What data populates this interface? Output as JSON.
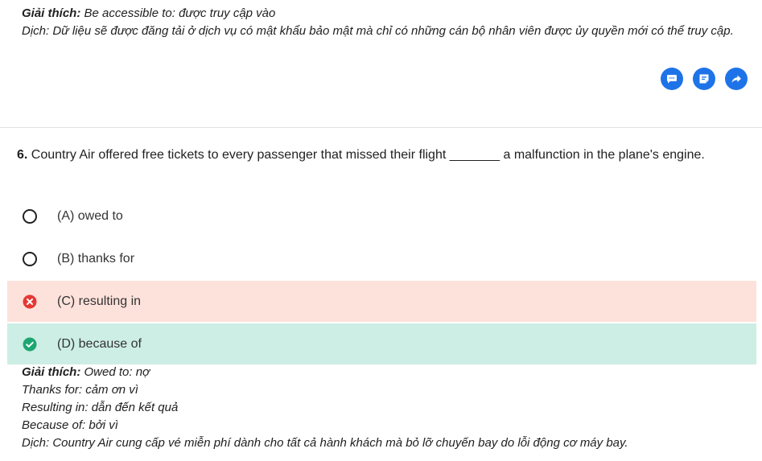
{
  "previous": {
    "explain_heading": "Giải thích:",
    "explain_text": " Be accessible to: được truy cập vào",
    "translation": "Dịch: Dữ liệu sẽ được đăng tải ở dịch vụ có mật khẩu bảo mật mà chỉ có những cán bộ nhân viên được ủy quyền mới có thể truy cập."
  },
  "actions": [
    {
      "icon": "comment-icon"
    },
    {
      "icon": "note-icon"
    },
    {
      "icon": "share-icon"
    }
  ],
  "question": {
    "number": "6.",
    "text": " Country Air offered free tickets to every passenger that missed their flight _______ a malfunction in the plane's engine."
  },
  "options": [
    {
      "label": "(A) owed to",
      "state": "none"
    },
    {
      "label": "(B) thanks for",
      "state": "none"
    },
    {
      "label": "(C) resulting in",
      "state": "wrong"
    },
    {
      "label": "(D) because of",
      "state": "correct"
    }
  ],
  "explanation": {
    "heading": "Giải thích:",
    "lines": [
      " Owed to: nợ",
      "Thanks for: cảm ơn vì",
      "Resulting in: dẫn đến kết quả",
      "Because of: bởi vì",
      "Dịch: Country Air cung cấp vé miễn phí dành cho tất cả hành khách mà bỏ lỡ chuyến bay do lỗi động cơ máy bay."
    ]
  },
  "colors": {
    "accent": "#1e73e8",
    "wrong_bg": "#fde1db",
    "wrong_icon": "#e53935",
    "correct_bg": "#cdeee4",
    "correct_icon": "#1ea672"
  }
}
